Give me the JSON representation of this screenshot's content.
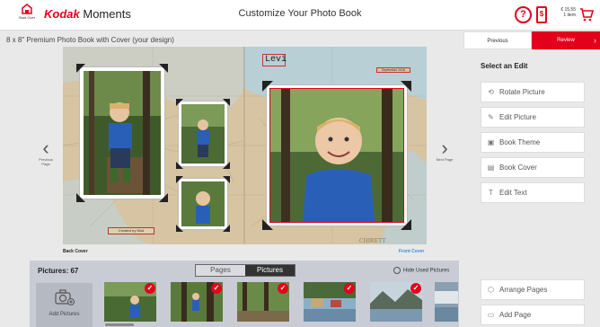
{
  "header": {
    "start_over_label": "Start Over",
    "brand_name": "Kodak",
    "brand_suffix": "Moments",
    "page_title": "Customize Your Photo Book",
    "help_symbol": "?",
    "price_icon_symbol": "$",
    "cart_price": "€ 15,55",
    "cart_items": "1 item",
    "accent_color": "#e3001b"
  },
  "book": {
    "title": "8 x 8\" Premium Photo Book with Cover (your design)",
    "back_cover_label": "Back Cover",
    "front_cover_label": "Front Cover",
    "title_text": "Levi",
    "date_text": "September 2018",
    "created_by_text": "Created by Mod",
    "map_text": "CHIRETT"
  },
  "navigation": {
    "previous_page_label": "Previous Page",
    "next_page_label": "Next Page"
  },
  "tray": {
    "pictures_count": "Pictures: 67",
    "tabs": [
      {
        "label": "Pages",
        "active": false
      },
      {
        "label": "Pictures",
        "active": true
      }
    ],
    "hide_used_label": "Hide Used Pictures",
    "add_pictures_label": "Add Pictures"
  },
  "panel": {
    "previous_label": "Previous",
    "review_label": "Review",
    "select_edit_label": "Select an Edit",
    "edit_buttons": [
      {
        "label": "Rotate Picture",
        "icon": "rotate-icon"
      },
      {
        "label": "Edit Picture",
        "icon": "edit-icon"
      },
      {
        "label": "Book Theme",
        "icon": "theme-icon"
      },
      {
        "label": "Book Cover",
        "icon": "book-cover-icon"
      },
      {
        "label": "Edit Text",
        "icon": "text-icon"
      }
    ],
    "arrange_pages_label": "Arrange Pages",
    "add_page_label": "Add Page"
  }
}
